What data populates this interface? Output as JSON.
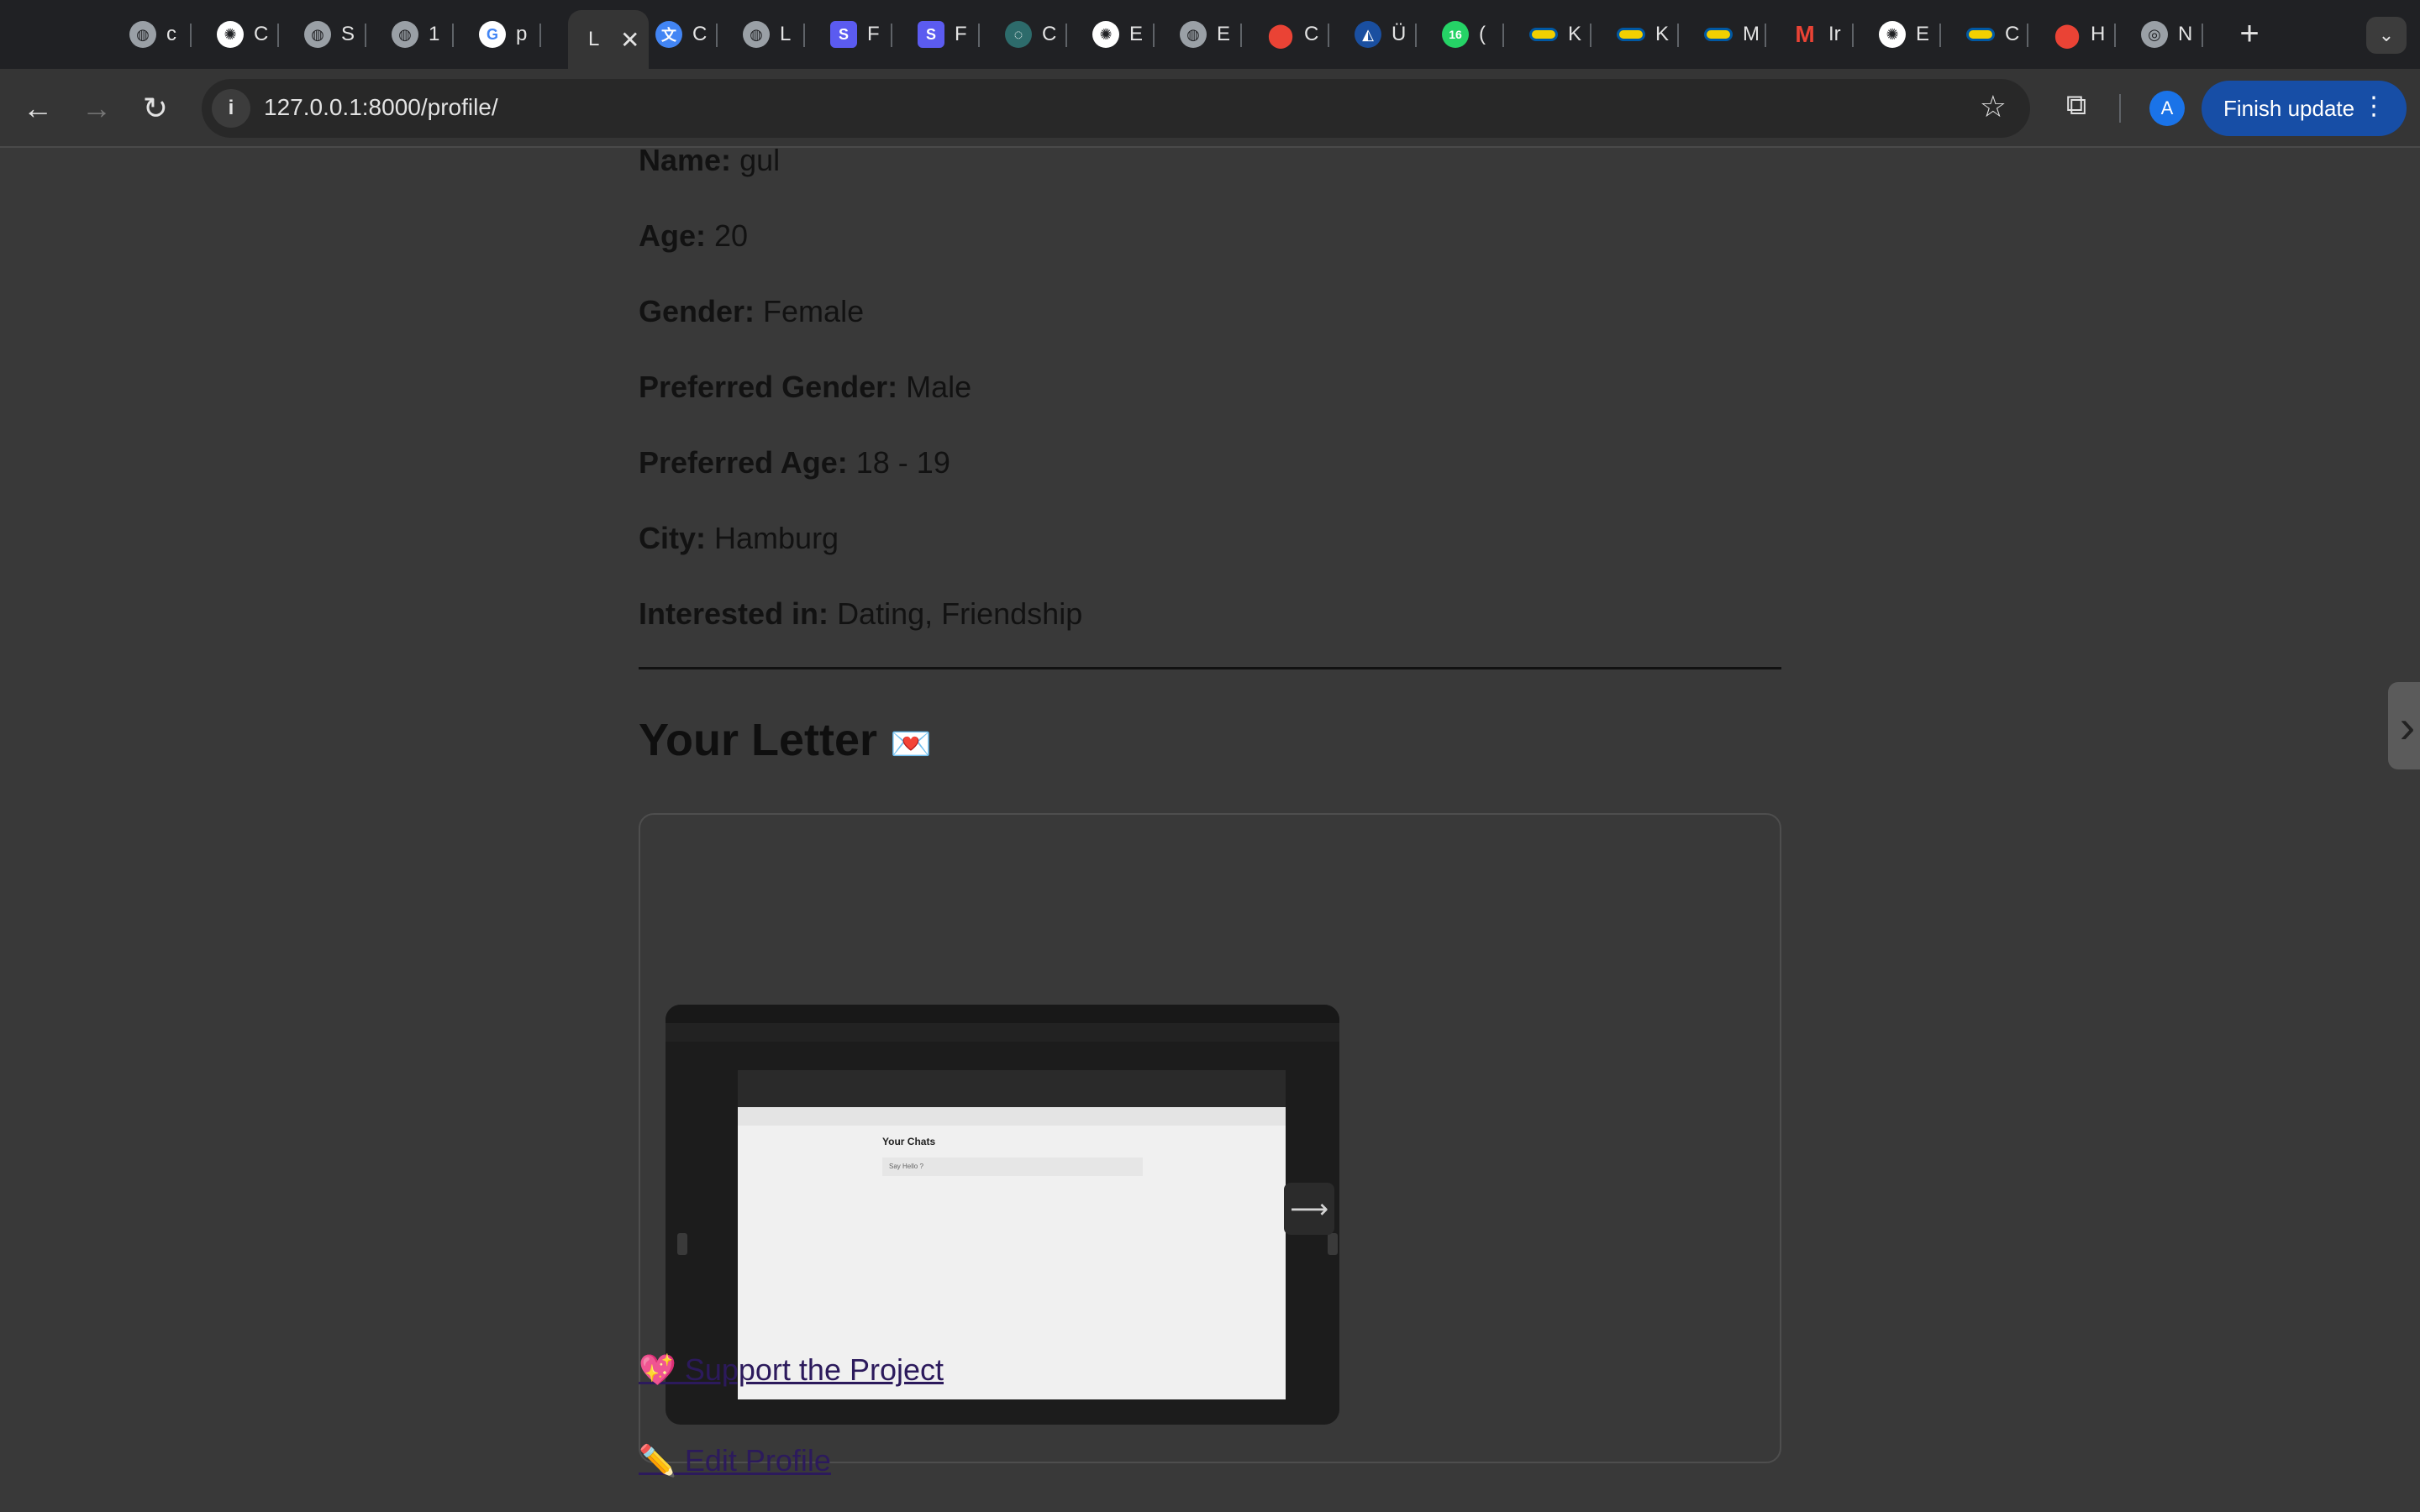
{
  "browser": {
    "tabs": [
      {
        "letter": "c",
        "icon": "globe-icon",
        "color": "#5f6368"
      },
      {
        "letter": "C",
        "icon": "openai-icon",
        "color": "#ffffff"
      },
      {
        "letter": "S",
        "icon": "globe-icon",
        "color": "#5f6368"
      },
      {
        "letter": "1",
        "icon": "globe-icon",
        "color": "#5f6368"
      },
      {
        "letter": "p",
        "icon": "google-icon",
        "color": "#ffffff"
      },
      {
        "letter": "C",
        "icon": "translate-icon",
        "color": "#4285f4"
      },
      {
        "letter": "L",
        "icon": "globe-icon",
        "color": "#5f6368"
      },
      {
        "letter": "F",
        "icon": "s-icon",
        "color": "#5b5bf0"
      },
      {
        "letter": "F",
        "icon": "s-icon",
        "color": "#5b5bf0"
      },
      {
        "letter": "C",
        "icon": "swirl-icon",
        "color": "#2d6b6b"
      },
      {
        "letter": "E",
        "icon": "openai-icon",
        "color": "#ffffff"
      },
      {
        "letter": "E",
        "icon": "globe-icon",
        "color": "#5f6368"
      },
      {
        "letter": "C",
        "icon": "maps-icon",
        "color": "#34a853"
      },
      {
        "letter": "Ü",
        "icon": "sign-icon",
        "color": "#1a4fa0"
      },
      {
        "letter": "(",
        "icon": "whatsapp-icon",
        "color": "#25d366"
      },
      {
        "letter": "K",
        "icon": "ikea-icon",
        "color": "#f2d000"
      },
      {
        "letter": "K",
        "icon": "ikea-icon",
        "color": "#f2d000"
      },
      {
        "letter": "M",
        "icon": "ikea-icon",
        "color": "#f2d000"
      },
      {
        "letter": "Ir",
        "icon": "gmail-icon",
        "color": "#ea4335"
      },
      {
        "letter": "E",
        "icon": "openai-icon",
        "color": "#ffffff"
      },
      {
        "letter": "C",
        "icon": "ikea-icon",
        "color": "#f2d000"
      },
      {
        "letter": "H",
        "icon": "maps-icon",
        "color": "#34a853"
      },
      {
        "letter": "N",
        "icon": "chrome-icon",
        "color": "#9aa0a6"
      }
    ],
    "active_tab": {
      "letter": "L",
      "close": "✕"
    },
    "whatsapp_badge": "16",
    "new_tab": "+",
    "tab_search": "⌄",
    "url": "127.0.0.1:8000/profile/",
    "profile_initial": "A",
    "finish_update": "Finish update"
  },
  "profile": {
    "name_label": "Name:",
    "name_value": "gul",
    "age_label": "Age:",
    "age_value": "20",
    "gender_label": "Gender:",
    "gender_value": "Female",
    "pref_gender_label": "Preferred Gender:",
    "pref_gender_value": "Male",
    "pref_age_label": "Preferred Age:",
    "pref_age_value": "18 - 19",
    "city_label": "City:",
    "city_value": "Hamburg",
    "interest_label": "Interested in:",
    "interest_value": "Dating, Friendship"
  },
  "letter": {
    "title": "Your Letter",
    "emoji": "💌",
    "screenshot_heading": "Your Chats",
    "screenshot_row": "Say Hello ?"
  },
  "links": {
    "support": "💖 Support the Project",
    "edit": "✏️ Edit Profile"
  }
}
